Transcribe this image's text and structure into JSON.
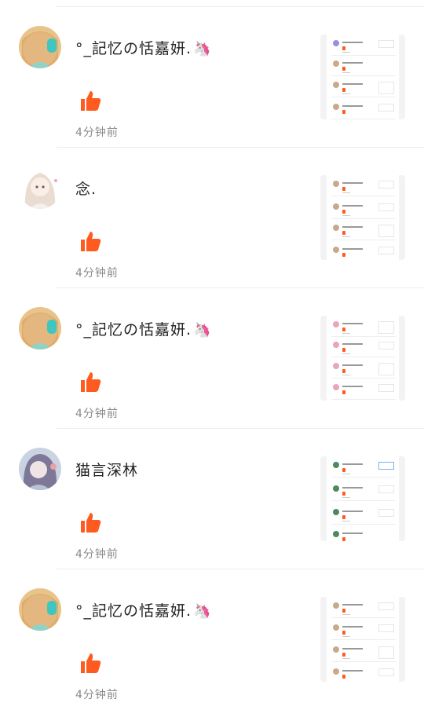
{
  "colors": {
    "like": "#ff5a1f",
    "time_text": "#8a8a8a",
    "divider": "#ececec"
  },
  "icons": {
    "like": "thumbs-up-icon",
    "unicorn": "unicorn-emoji"
  },
  "comments": [
    {
      "username": "°_記忆の恬嘉妍.",
      "emoji": "🦄",
      "time": "4分钟前",
      "avatar": "avatar-teal-girl"
    },
    {
      "username": "念.",
      "emoji": "",
      "time": "4分钟前",
      "avatar": "avatar-anime-girl"
    },
    {
      "username": "°_記忆の恬嘉妍.",
      "emoji": "🦄",
      "time": "4分钟前",
      "avatar": "avatar-teal-girl"
    },
    {
      "username": "猫言深林",
      "emoji": "",
      "time": "4分钟前",
      "avatar": "avatar-purple-girl"
    },
    {
      "username": "°_記忆の恬嘉妍.",
      "emoji": "🦄",
      "time": "4分钟前",
      "avatar": "avatar-teal-girl"
    }
  ]
}
